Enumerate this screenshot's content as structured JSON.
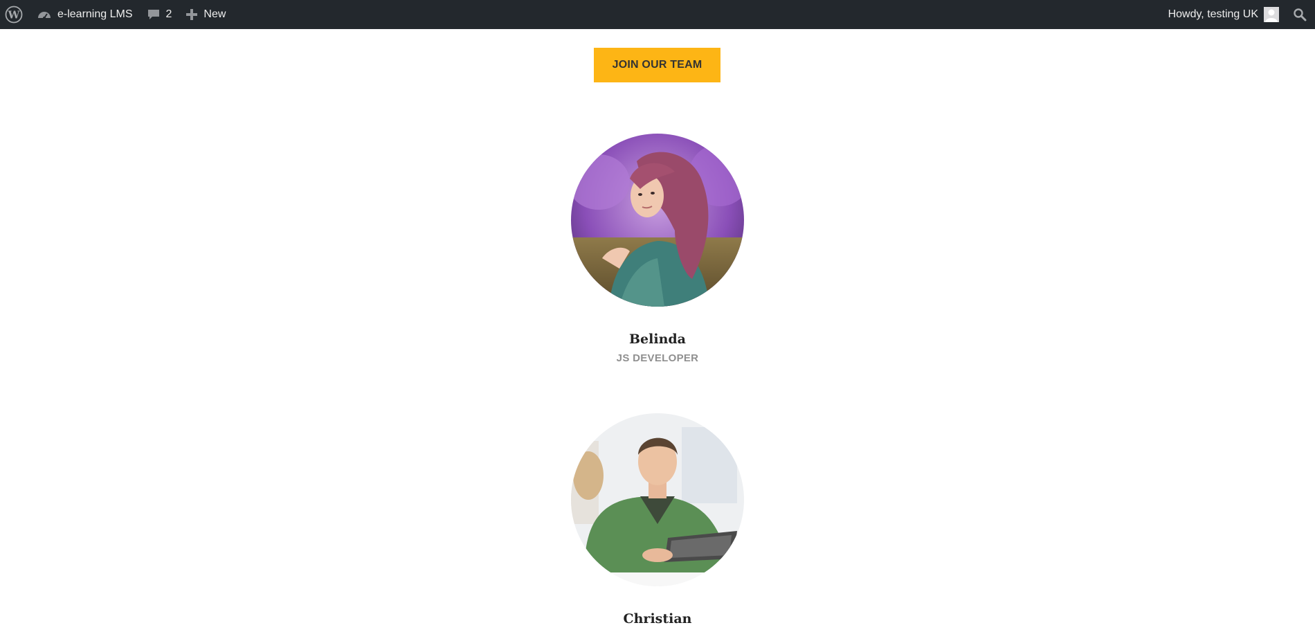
{
  "adminbar": {
    "wp_logo_icon": "wordpress-logo-icon",
    "site_name": "e-learning LMS",
    "site_icon": "dashboard-icon",
    "comments_count": "2",
    "comments_icon": "comment-bubble-icon",
    "new_label": "New",
    "new_icon": "plus-icon",
    "howdy_text": "Howdy, testing UK",
    "avatar_icon": "user-avatar-icon",
    "search_icon": "search-icon"
  },
  "main": {
    "join_button_label": "JOIN OUR TEAM",
    "team": [
      {
        "name": "Belinda",
        "role": "JS DEVELOPER",
        "photo": "woman-with-pink-hair-photo"
      },
      {
        "name": "Christian",
        "role": "",
        "photo": "man-with-tablet-photo"
      }
    ]
  },
  "colors": {
    "adminbar_bg": "#23282d",
    "accent": "#fdb515",
    "role_text": "#8f8f8f"
  }
}
